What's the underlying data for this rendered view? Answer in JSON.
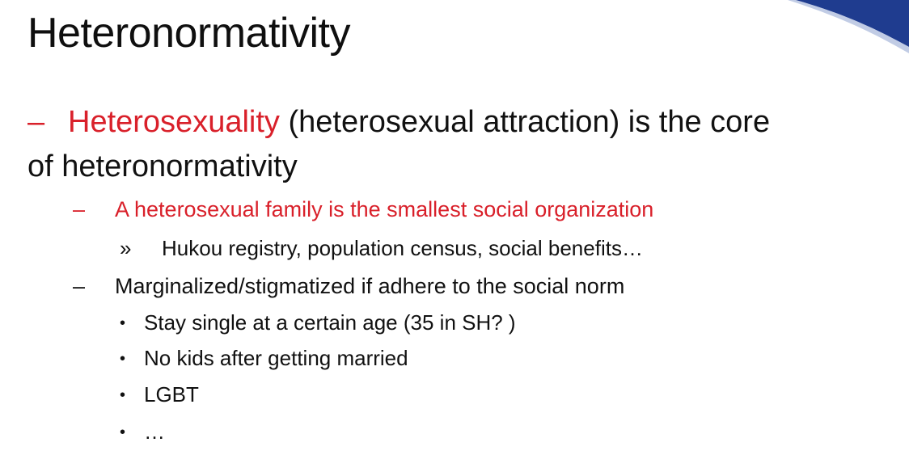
{
  "slide": {
    "title": "Heteronormativity",
    "colors": {
      "accent_red": "#d9202a",
      "text": "#111111",
      "corner_swoosh": "#1f3c8f"
    },
    "level1": {
      "marker": "–",
      "highlight": "Heterosexuality",
      "rest": " (heterosexual attraction) is the core",
      "continuation": "of heteronormativity"
    },
    "level2a": {
      "marker": "–",
      "text": "A heterosexual family is the smallest social organization"
    },
    "level3a": {
      "marker": "»",
      "text": "Hukou registry, population census, social benefits…"
    },
    "level2b": {
      "marker": "–",
      "text": "Marginalized/stigmatized if adhere to the social norm"
    },
    "bullets": [
      {
        "marker": "•",
        "text": "Stay single at a certain age (35 in SH? )"
      },
      {
        "marker": "•",
        "text": "No kids after getting married"
      },
      {
        "marker": "•",
        "text": "LGBT"
      },
      {
        "marker": "•",
        "text": "…"
      }
    ]
  }
}
